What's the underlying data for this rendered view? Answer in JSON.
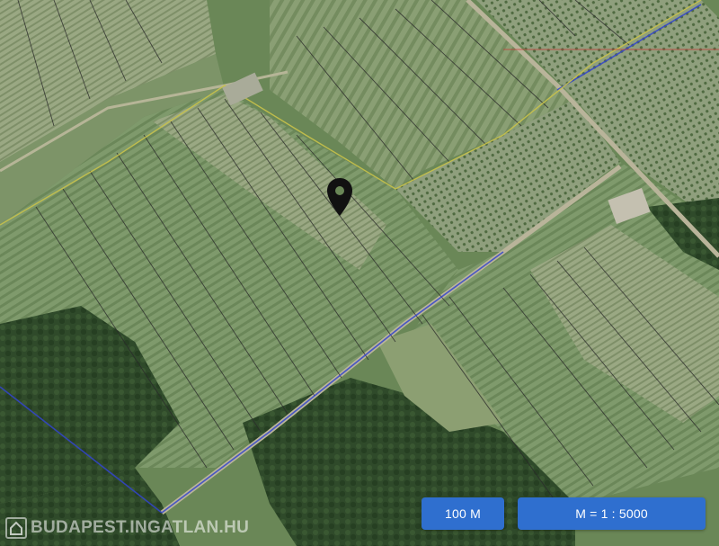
{
  "map": {
    "kind": "satellite-cadastral",
    "marker": {
      "icon": "map-pin-icon",
      "color": "#111111"
    },
    "colors": {
      "parcel_line": "#2a2a2a",
      "boundary_blue": "#3344cc",
      "boundary_yellow": "#c9c24a",
      "forest": "#2f4a2a",
      "field_light": "#8fa27b",
      "field_green": "#6e8c5a"
    }
  },
  "controls": {
    "scale_label": "100 M",
    "ratio_label": "M = 1 : 5000",
    "button_color": "#2f6fcf"
  },
  "watermark": {
    "text": "BUDAPEST.INGATLAN.HU",
    "icon": "house-logo-icon"
  }
}
